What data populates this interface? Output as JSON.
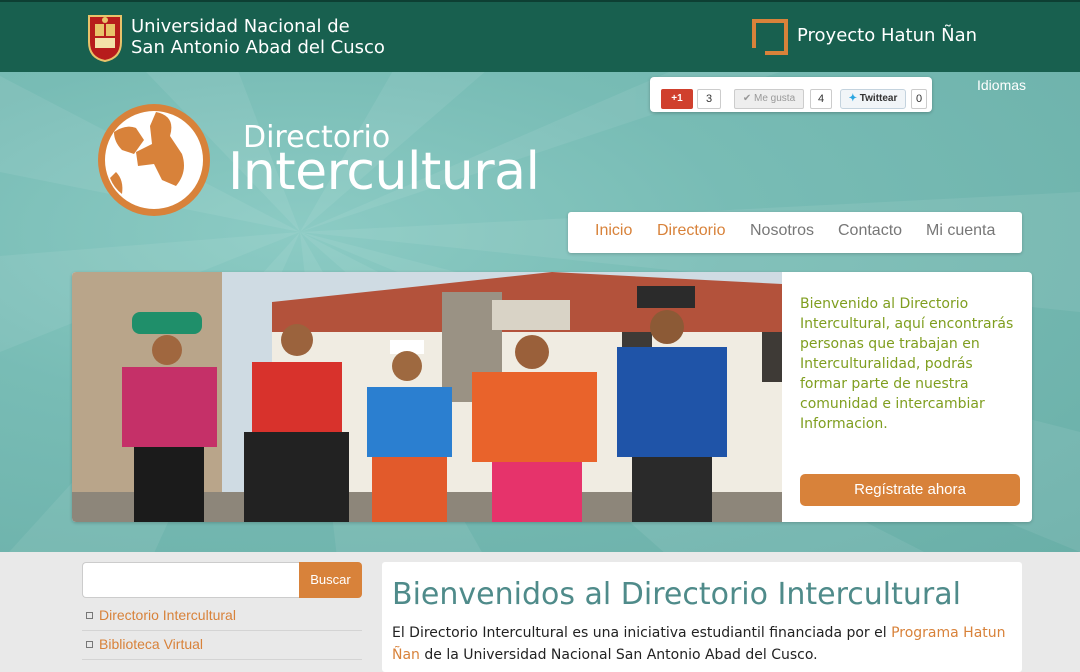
{
  "header": {
    "university_line1": "Universidad Nacional de",
    "university_line2": "San Antonio Abad del Cusco",
    "project_title": "Proyecto Hatun Ñan",
    "colors": {
      "bar": "#18604f",
      "accent": "#d8823a"
    }
  },
  "social": {
    "gplus_label": "+1",
    "gplus_count": "3",
    "facebook_label": "✔ Me gusta",
    "facebook_count": "4",
    "twitter_label": "Twittear",
    "twitter_count": "0"
  },
  "languages_link": "Idiomas",
  "logo": {
    "line1": "Directorio",
    "line2": "Intercultural"
  },
  "nav": {
    "items": [
      {
        "label": "Inicio",
        "color": "#d8823a"
      },
      {
        "label": "Directorio",
        "color": "#d8823a"
      },
      {
        "label": "Nosotros",
        "color": "#777777"
      },
      {
        "label": "Contacto",
        "color": "#777777"
      },
      {
        "label": "Mi cuenta",
        "color": "#777777"
      }
    ]
  },
  "banner": {
    "welcome_text": "Bienvenido al Directorio Intercultural, aquí encontrarás personas que trabajan en Interculturalidad, podrás formar parte de nuestra comunidad e intercambiar Informacion.",
    "register_button": "Regístrate ahora"
  },
  "sidebar": {
    "search_button": "Buscar",
    "search_value": "",
    "links": [
      {
        "label": "Directorio Intercultural"
      },
      {
        "label": "Biblioteca Virtual"
      }
    ]
  },
  "main": {
    "heading": "Bienvenidos al Directorio Intercultural",
    "intro_before": "El Directorio Intercultural es una iniciativa estudiantil financiada por el ",
    "intro_link": "Programa Hatun Ñan",
    "intro_after": " de la Universidad Nacional San Antonio Abad del Cusco."
  }
}
